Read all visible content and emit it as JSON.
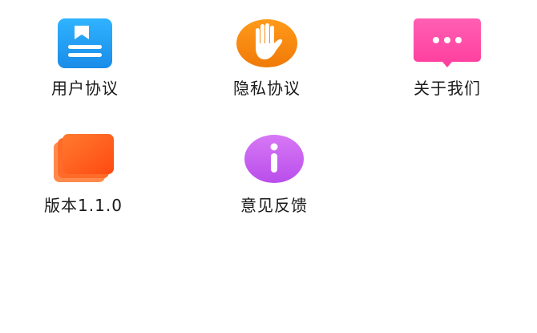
{
  "menu": {
    "items": [
      {
        "label": "用户协议",
        "icon": "document-icon",
        "color": "#1E9BF0"
      },
      {
        "label": "隐私协议",
        "icon": "hand-stop-icon",
        "color": "#F5860C"
      },
      {
        "label": "关于我们",
        "icon": "chat-bubble-icon",
        "color": "#FF4FA8"
      },
      {
        "label": "版本1.1.0",
        "icon": "stacked-cards-icon",
        "color": "#FF5A1F"
      },
      {
        "label": "意见反馈",
        "icon": "info-icon",
        "color": "#C65CF0"
      }
    ]
  }
}
